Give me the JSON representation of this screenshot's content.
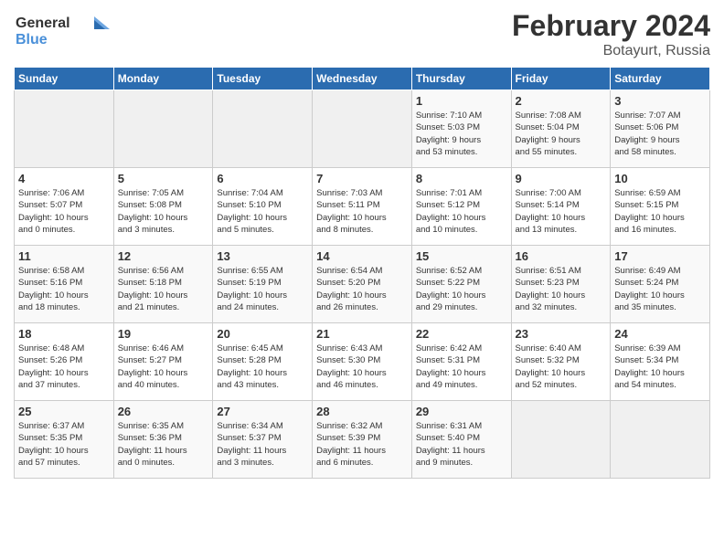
{
  "header": {
    "logo_line1": "General",
    "logo_line2": "Blue",
    "title": "February 2024",
    "subtitle": "Botayurt, Russia"
  },
  "days_of_week": [
    "Sunday",
    "Monday",
    "Tuesday",
    "Wednesday",
    "Thursday",
    "Friday",
    "Saturday"
  ],
  "weeks": [
    [
      {
        "day": "",
        "info": ""
      },
      {
        "day": "",
        "info": ""
      },
      {
        "day": "",
        "info": ""
      },
      {
        "day": "",
        "info": ""
      },
      {
        "day": "1",
        "info": "Sunrise: 7:10 AM\nSunset: 5:03 PM\nDaylight: 9 hours\nand 53 minutes."
      },
      {
        "day": "2",
        "info": "Sunrise: 7:08 AM\nSunset: 5:04 PM\nDaylight: 9 hours\nand 55 minutes."
      },
      {
        "day": "3",
        "info": "Sunrise: 7:07 AM\nSunset: 5:06 PM\nDaylight: 9 hours\nand 58 minutes."
      }
    ],
    [
      {
        "day": "4",
        "info": "Sunrise: 7:06 AM\nSunset: 5:07 PM\nDaylight: 10 hours\nand 0 minutes."
      },
      {
        "day": "5",
        "info": "Sunrise: 7:05 AM\nSunset: 5:08 PM\nDaylight: 10 hours\nand 3 minutes."
      },
      {
        "day": "6",
        "info": "Sunrise: 7:04 AM\nSunset: 5:10 PM\nDaylight: 10 hours\nand 5 minutes."
      },
      {
        "day": "7",
        "info": "Sunrise: 7:03 AM\nSunset: 5:11 PM\nDaylight: 10 hours\nand 8 minutes."
      },
      {
        "day": "8",
        "info": "Sunrise: 7:01 AM\nSunset: 5:12 PM\nDaylight: 10 hours\nand 10 minutes."
      },
      {
        "day": "9",
        "info": "Sunrise: 7:00 AM\nSunset: 5:14 PM\nDaylight: 10 hours\nand 13 minutes."
      },
      {
        "day": "10",
        "info": "Sunrise: 6:59 AM\nSunset: 5:15 PM\nDaylight: 10 hours\nand 16 minutes."
      }
    ],
    [
      {
        "day": "11",
        "info": "Sunrise: 6:58 AM\nSunset: 5:16 PM\nDaylight: 10 hours\nand 18 minutes."
      },
      {
        "day": "12",
        "info": "Sunrise: 6:56 AM\nSunset: 5:18 PM\nDaylight: 10 hours\nand 21 minutes."
      },
      {
        "day": "13",
        "info": "Sunrise: 6:55 AM\nSunset: 5:19 PM\nDaylight: 10 hours\nand 24 minutes."
      },
      {
        "day": "14",
        "info": "Sunrise: 6:54 AM\nSunset: 5:20 PM\nDaylight: 10 hours\nand 26 minutes."
      },
      {
        "day": "15",
        "info": "Sunrise: 6:52 AM\nSunset: 5:22 PM\nDaylight: 10 hours\nand 29 minutes."
      },
      {
        "day": "16",
        "info": "Sunrise: 6:51 AM\nSunset: 5:23 PM\nDaylight: 10 hours\nand 32 minutes."
      },
      {
        "day": "17",
        "info": "Sunrise: 6:49 AM\nSunset: 5:24 PM\nDaylight: 10 hours\nand 35 minutes."
      }
    ],
    [
      {
        "day": "18",
        "info": "Sunrise: 6:48 AM\nSunset: 5:26 PM\nDaylight: 10 hours\nand 37 minutes."
      },
      {
        "day": "19",
        "info": "Sunrise: 6:46 AM\nSunset: 5:27 PM\nDaylight: 10 hours\nand 40 minutes."
      },
      {
        "day": "20",
        "info": "Sunrise: 6:45 AM\nSunset: 5:28 PM\nDaylight: 10 hours\nand 43 minutes."
      },
      {
        "day": "21",
        "info": "Sunrise: 6:43 AM\nSunset: 5:30 PM\nDaylight: 10 hours\nand 46 minutes."
      },
      {
        "day": "22",
        "info": "Sunrise: 6:42 AM\nSunset: 5:31 PM\nDaylight: 10 hours\nand 49 minutes."
      },
      {
        "day": "23",
        "info": "Sunrise: 6:40 AM\nSunset: 5:32 PM\nDaylight: 10 hours\nand 52 minutes."
      },
      {
        "day": "24",
        "info": "Sunrise: 6:39 AM\nSunset: 5:34 PM\nDaylight: 10 hours\nand 54 minutes."
      }
    ],
    [
      {
        "day": "25",
        "info": "Sunrise: 6:37 AM\nSunset: 5:35 PM\nDaylight: 10 hours\nand 57 minutes."
      },
      {
        "day": "26",
        "info": "Sunrise: 6:35 AM\nSunset: 5:36 PM\nDaylight: 11 hours\nand 0 minutes."
      },
      {
        "day": "27",
        "info": "Sunrise: 6:34 AM\nSunset: 5:37 PM\nDaylight: 11 hours\nand 3 minutes."
      },
      {
        "day": "28",
        "info": "Sunrise: 6:32 AM\nSunset: 5:39 PM\nDaylight: 11 hours\nand 6 minutes."
      },
      {
        "day": "29",
        "info": "Sunrise: 6:31 AM\nSunset: 5:40 PM\nDaylight: 11 hours\nand 9 minutes."
      },
      {
        "day": "",
        "info": ""
      },
      {
        "day": "",
        "info": ""
      }
    ]
  ]
}
